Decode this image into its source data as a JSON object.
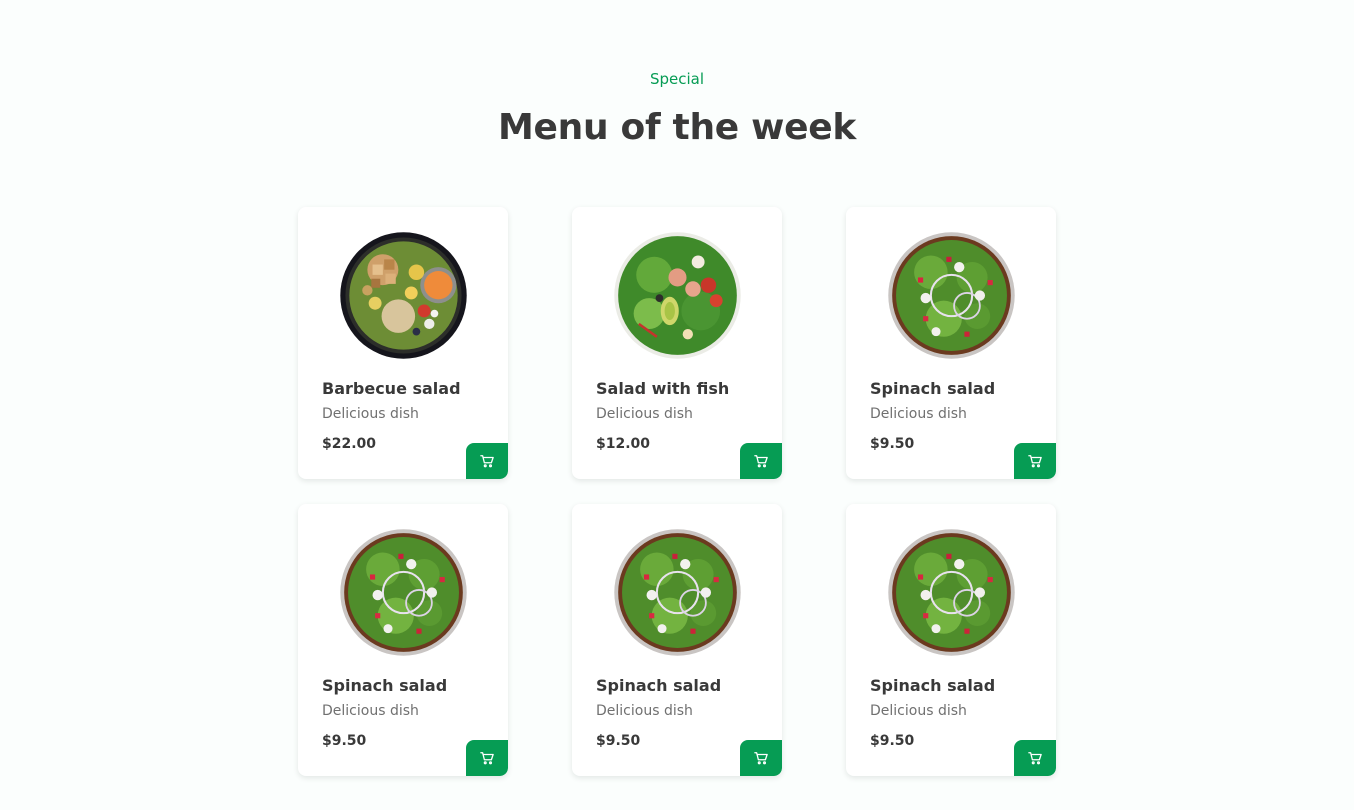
{
  "section": {
    "subtitle": "Special",
    "title": "Menu of the week"
  },
  "menu": {
    "items": [
      {
        "name": "Barbecue salad",
        "description": "Delicious dish",
        "price": "$22.00",
        "image": "barbecue-salad"
      },
      {
        "name": "Salad with fish",
        "description": "Delicious dish",
        "price": "$12.00",
        "image": "fish-salad"
      },
      {
        "name": "Spinach salad",
        "description": "Delicious dish",
        "price": "$9.50",
        "image": "spinach-salad"
      },
      {
        "name": "Spinach salad",
        "description": "Delicious dish",
        "price": "$9.50",
        "image": "spinach-salad"
      },
      {
        "name": "Spinach salad",
        "description": "Delicious dish",
        "price": "$9.50",
        "image": "spinach-salad"
      },
      {
        "name": "Spinach salad",
        "description": "Delicious dish",
        "price": "$9.50",
        "image": "spinach-salad"
      }
    ]
  },
  "colors": {
    "accent": "#069c54",
    "title": "#393939",
    "text": "#707070",
    "background": "#fbfefd"
  },
  "icons": {
    "cart_button": "cart-icon"
  }
}
